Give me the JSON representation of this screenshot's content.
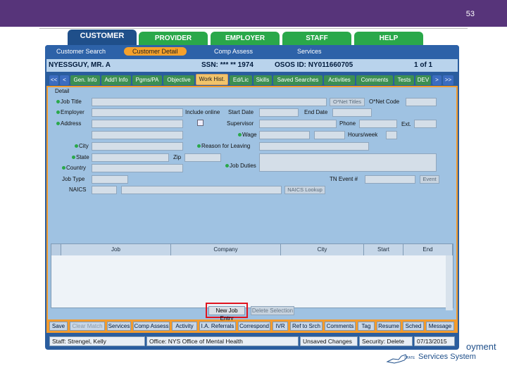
{
  "slide": {
    "page_number": "53"
  },
  "top_tabs": [
    {
      "label": "CUSTOMER"
    },
    {
      "label": "PROVIDER"
    },
    {
      "label": "EMPLOYER"
    },
    {
      "label": "STAFF"
    },
    {
      "label": "HELP"
    }
  ],
  "subnav": {
    "items": [
      "Customer Search",
      "Customer Detail",
      "Comp Assess",
      "Services"
    ]
  },
  "customer": {
    "name": "NYESSGUY, MR. A",
    "ssn": "SSN: *** ** 1974",
    "osos": "OSOS ID: NY011660705",
    "pager": "1 of 1"
  },
  "button_tabs": [
    "<<",
    "<",
    "Gen. Info",
    "Add'l Info",
    "Pgms/PA",
    "Objective",
    "Work Hist.",
    "Ed/Lic",
    "Skills",
    "Saved Searches",
    "Activities",
    "Comments",
    "Tests",
    "DEV",
    ">",
    ">>"
  ],
  "detail": {
    "section_label": "Detail",
    "job_title": "Job Title",
    "onet_titles_btn": "O*Net Titles",
    "onet_code": "O*Net Code",
    "employer": "Employer",
    "include_online": "Include online",
    "start_date": "Start Date",
    "end_date": "End Date",
    "address": "Address",
    "supervisor": "Supervisor",
    "phone": "Phone",
    "ext": "Ext.",
    "wage": "Wage",
    "hours_week": "Hours/week",
    "city": "City",
    "reason_leaving": "Reason for Leaving",
    "state": "State",
    "zip": "Zip",
    "country": "Country",
    "job_duties": "Job Duties",
    "job_type": "Job Type",
    "tn_event": "TN Event #",
    "event_btn": "Event",
    "naics": "NAICS",
    "naics_lookup": "NAICS Lookup"
  },
  "grid": {
    "columns": [
      "Job",
      "Company",
      "City",
      "Start",
      "End"
    ]
  },
  "actions": {
    "new_job_entry": "New Job Entry",
    "delete_selection": "Delete Selection"
  },
  "bottom_buttons": [
    "Save",
    "Clear Match",
    "Services",
    "Comp Assess",
    "Activity",
    "I.A. Referrals",
    "Correspond",
    "IVR",
    "Ref to Srch",
    "Comments",
    "Tag",
    "Resume",
    "Sched",
    "Message"
  ],
  "status_bar": {
    "staff": "Staff: Strengel, Kelly",
    "office": "Office: NYS Office of Mental Health",
    "unsaved": "Unsaved Changes",
    "security": "Security: Delete",
    "date": "07/13/2015"
  },
  "logo": {
    "line1": "oyment",
    "line2": "Services System",
    "mark": "STATE"
  },
  "colors": {
    "header_purple": "#57347a",
    "tab_green": "#2aa84a",
    "app_blue": "#2a5d9e",
    "accent_orange": "#f39b2d",
    "highlight_red": "#e0141f"
  }
}
